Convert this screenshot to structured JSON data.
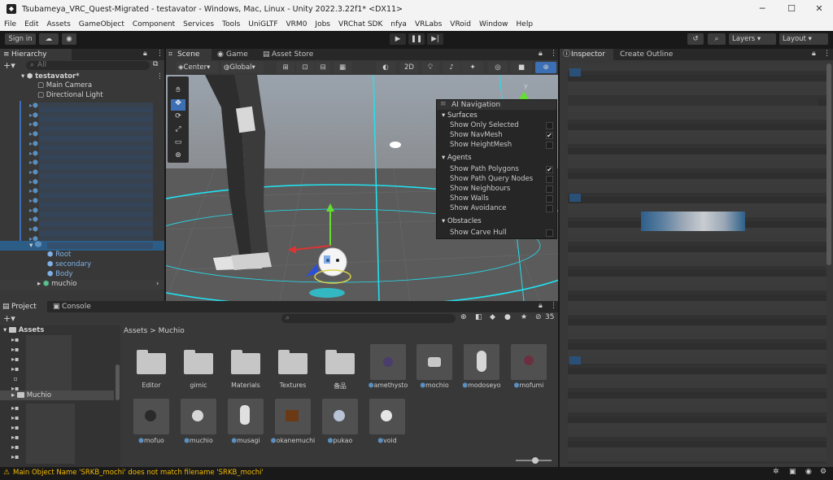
{
  "window": {
    "title": "Tsubameya_VRC_Quest-Migrated - testavator - Windows, Mac, Linux - Unity 2022.3.22f1* <DX11>",
    "minimize": "─",
    "maximize": "☐",
    "close": "✕"
  },
  "menu": [
    "File",
    "Edit",
    "Assets",
    "GameObject",
    "Component",
    "Services",
    "Tools",
    "UniGLTF",
    "VRM0",
    "Jobs",
    "VRChat SDK",
    "nfya",
    "VRLabs",
    "VRoid",
    "Window",
    "Help"
  ],
  "toolbar": {
    "signin": "Sign in",
    "layers": "Layers",
    "layout": "Layout"
  },
  "hierarchy": {
    "tab": "Hierarchy",
    "search_placeholder": "All",
    "scene": "testavator*",
    "items": [
      "Main Camera",
      "Directional Light"
    ],
    "children": [
      "Root",
      "secondary",
      "Body"
    ],
    "last": "muchio"
  },
  "scene_tabs": [
    "Scene",
    "Game",
    "Asset Store"
  ],
  "scene_toolbar": {
    "center": "Center",
    "global": "Global",
    "mode2d": "2D"
  },
  "ai_nav": {
    "title": "AI Navigation",
    "sections": [
      {
        "name": "Surfaces",
        "rows": [
          {
            "label": "Show Only Selected",
            "checked": ""
          },
          {
            "label": "Show NavMesh",
            "checked": "✔"
          },
          {
            "label": "Show HeightMesh",
            "checked": ""
          }
        ]
      },
      {
        "name": "Agents",
        "rows": [
          {
            "label": "Show Path Polygons",
            "checked": "✔"
          },
          {
            "label": "Show Path Query Nodes",
            "checked": ""
          },
          {
            "label": "Show Neighbours",
            "checked": ""
          },
          {
            "label": "Show Walls",
            "checked": ""
          },
          {
            "label": "Show Avoidance",
            "checked": ""
          }
        ]
      },
      {
        "name": "Obstacles",
        "rows": [
          {
            "label": "Show Carve Hull",
            "checked": ""
          }
        ]
      }
    ]
  },
  "inspector": {
    "tab1": "Inspector",
    "tab2": "Create Outline"
  },
  "project": {
    "tab1": "Project",
    "tab2": "Console",
    "assets_root": "Assets",
    "muchio_folder": "Muchio",
    "breadcrumb_root": "Assets",
    "breadcrumb_sep": ">",
    "breadcrumb_leaf": "Muchio",
    "hidden_count": "35",
    "folders": [
      "Editor",
      "gimic",
      "Materials",
      "Textures",
      "备品"
    ],
    "row1_assets": [
      "amethysto",
      "mochio",
      "modoseyo",
      "mofumi"
    ],
    "row2_assets": [
      "mofuo",
      "muchio",
      "musagi",
      "okanemuchi",
      "pukao",
      "void"
    ]
  },
  "status": {
    "warning": "Main Object Name 'SRKB_mochi' does not match filename 'SRKB_mochi'"
  },
  "colors": {
    "accent": "#3d6fb5",
    "selection": "#2c5d87",
    "warning": "#f4bc02",
    "nav_cyan": "#22e0ef"
  }
}
